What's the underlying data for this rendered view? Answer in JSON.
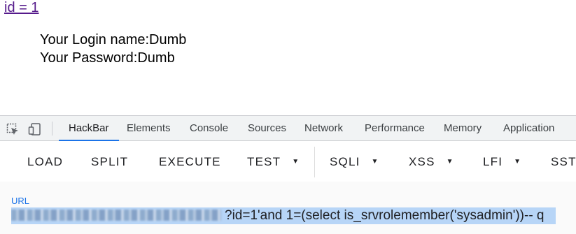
{
  "page": {
    "link_text": "id = 1",
    "login_line": "Your Login name:Dumb",
    "password_line": "Your Password:Dumb"
  },
  "devtools": {
    "icons": [
      "inspect-element-icon",
      "device-toggle-icon"
    ],
    "tabs": [
      "HackBar",
      "Elements",
      "Console",
      "Sources",
      "Network",
      "Performance",
      "Memory",
      "Application"
    ],
    "active_tab": "HackBar"
  },
  "hackbar": {
    "buttons": {
      "load": "LOAD",
      "split": "SPLIT",
      "execute": "EXECUTE",
      "test": "TEST",
      "sqli": "SQLI",
      "xss": "XSS",
      "lfi": "LFI",
      "ssti": "SST"
    },
    "url_label": "URL",
    "url_value": "?id=1'and 1=(select is_srvrolemember('sysadmin'))-- q"
  },
  "colors": {
    "active_tab_underline": "#1a73e8",
    "url_label": "#1a73e8",
    "url_selection": "#b7d5f7",
    "visited_link": "#551a8b"
  }
}
